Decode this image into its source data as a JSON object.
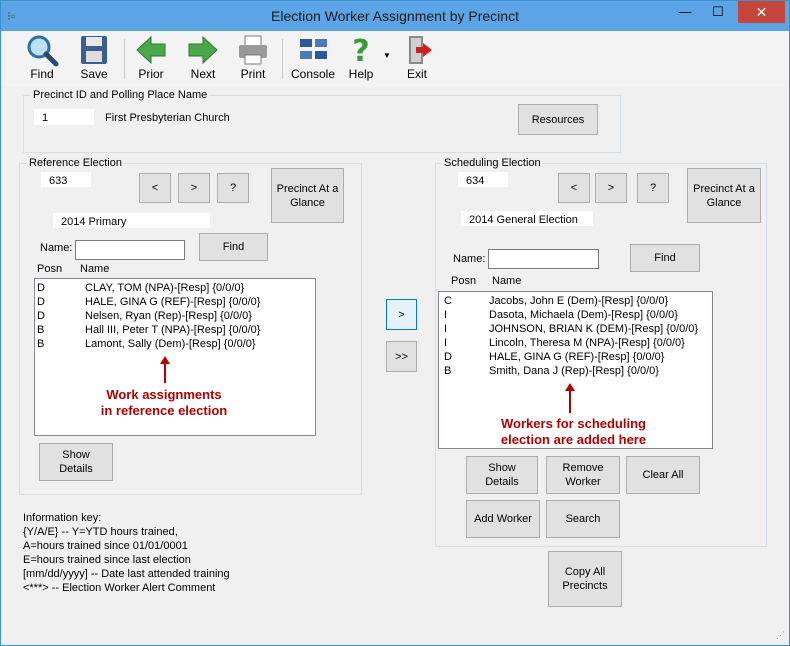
{
  "window": {
    "title": "Election Worker Assignment by Precinct"
  },
  "toolbar": {
    "find": "Find",
    "save": "Save",
    "prior": "Prior",
    "next": "Next",
    "print": "Print",
    "console": "Console",
    "help": "Help",
    "exit": "Exit"
  },
  "precinct": {
    "group_label": "Precinct ID and Polling Place Name",
    "id": "1",
    "name": "First Presbyterian Church",
    "resources": "Resources"
  },
  "reference": {
    "group_label": "Reference Election",
    "election_id": "633",
    "election_name": "2014 Primary",
    "prev": "<",
    "next": ">",
    "help": "?",
    "glance": "Precinct At a Glance",
    "name_label": "Name:",
    "find": "Find",
    "col_posn": "Posn",
    "col_name": "Name",
    "rows": [
      {
        "posn": "D",
        "name": "CLAY, TOM (NPA)-[Resp] {0/0/0}"
      },
      {
        "posn": "D",
        "name": "HALE, GINA G (REF)-[Resp] {0/0/0}"
      },
      {
        "posn": "D",
        "name": "Nelsen, Ryan (Rep)-[Resp] {0/0/0}"
      },
      {
        "posn": "B",
        "name": "Hall III, Peter T (NPA)-[Resp] {0/0/0}"
      },
      {
        "posn": "B",
        "name": "Lamont, Sally (Dem)-[Resp] {0/0/0}"
      }
    ],
    "annotation_line1": "Work assignments",
    "annotation_line2": "in reference election",
    "show_details": "Show Details"
  },
  "transfer": {
    "one": ">",
    "all": ">>"
  },
  "scheduling": {
    "group_label": "Scheduling Election",
    "election_id": "634",
    "election_name": "2014 General Election",
    "prev": "<",
    "next": ">",
    "help": "?",
    "glance": "Precinct At a Glance",
    "name_label": "Name:",
    "find": "Find",
    "col_posn": "Posn",
    "col_name": "Name",
    "rows": [
      {
        "posn": "C",
        "name": "Jacobs, John E (Dem)-[Resp] {0/0/0}"
      },
      {
        "posn": "I",
        "name": "Dasota, Michaela (Dem)-[Resp] {0/0/0}"
      },
      {
        "posn": "I",
        "name": "JOHNSON, BRIAN K (DEM)-[Resp] {0/0/0}"
      },
      {
        "posn": "I",
        "name": "Lincoln, Theresa M (NPA)-[Resp] {0/0/0}"
      },
      {
        "posn": "D",
        "name": "HALE, GINA G (REF)-[Resp] {0/0/0}"
      },
      {
        "posn": "B",
        "name": "Smith, Dana J (Rep)-[Resp] {0/0/0}"
      }
    ],
    "annotation_line1": "Workers for scheduling",
    "annotation_line2": "election are added here",
    "show_details": "Show Details",
    "remove_worker": "Remove Worker",
    "clear_all": "Clear All",
    "add_worker": "Add Worker",
    "search": "Search"
  },
  "copy_all": "Copy All Precincts",
  "info_key": [
    "Information key:",
    "{Y/A/E} -- Y=YTD hours trained,",
    "A=hours trained since 01/01/0001",
    "E=hours trained since last election",
    "[mm/dd/yyyy] -- Date last attended training",
    "<***> -- Election Worker Alert Comment"
  ]
}
